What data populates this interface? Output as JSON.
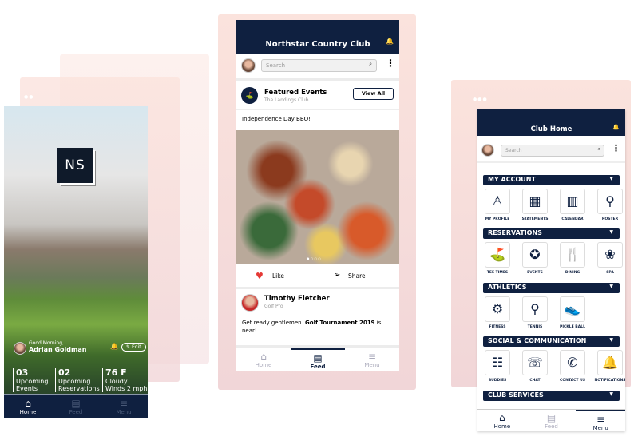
{
  "left": {
    "logo": "NS",
    "greeting": "Good Morning,",
    "user": "Adrian Goldman",
    "edit": "Edit",
    "stats": [
      {
        "value": "03",
        "label1": "Upcoming",
        "label2": "Events"
      },
      {
        "value": "02",
        "label1": "Upcoming",
        "label2": "Reservations"
      },
      {
        "value": "76 F",
        "label1": "Cloudy",
        "label2": "Winds 2 mph"
      }
    ],
    "nav": [
      {
        "icon": "home-icon",
        "label": "Home"
      },
      {
        "icon": "feed-icon",
        "label": "Feed"
      },
      {
        "icon": "menu-icon",
        "label": "Menu"
      }
    ]
  },
  "center": {
    "title": "Northstar Country Club",
    "search_placeholder": "Search",
    "featured": {
      "title": "Featured Events",
      "subtitle": "The Landings Club",
      "view_all": "View All",
      "post": "Independence Day BBQ!",
      "like": "Like",
      "share": "Share"
    },
    "post": {
      "author": "Timothy Fletcher",
      "role": "Golf Pro",
      "text_pre": "Get ready gentlemen. ",
      "text_bold": "Golf Tournament 2019",
      "text_post": " is near!"
    },
    "nav": [
      {
        "icon": "home-icon",
        "label": "Home"
      },
      {
        "icon": "feed-icon",
        "label": "Feed"
      },
      {
        "icon": "menu-icon",
        "label": "Menu"
      }
    ]
  },
  "right": {
    "title": "Club Home",
    "search_placeholder": "Search",
    "sections": [
      {
        "title": "MY ACCOUNT",
        "items": [
          {
            "label": "MY PROFILE",
            "icon": "profile-icon"
          },
          {
            "label": "STATEMENTS",
            "icon": "statements-icon"
          },
          {
            "label": "CALENDAR",
            "icon": "calendar-icon"
          },
          {
            "label": "ROSTER",
            "icon": "roster-icon"
          }
        ]
      },
      {
        "title": "RESERVATIONS",
        "items": [
          {
            "label": "TEE TIMES",
            "icon": "golfer-icon"
          },
          {
            "label": "EVENTS",
            "icon": "events-icon"
          },
          {
            "label": "DINING",
            "icon": "dining-icon"
          },
          {
            "label": "SPA",
            "icon": "lotus-icon"
          }
        ]
      },
      {
        "title": "ATHLETICS",
        "items": [
          {
            "label": "FITNESS",
            "icon": "bike-icon"
          },
          {
            "label": "TENNIS",
            "icon": "tennis-icon"
          },
          {
            "label": "PICKLE BALL",
            "icon": "shoe-icon"
          }
        ]
      },
      {
        "title": "SOCIAL & COMMUNICATION",
        "items": [
          {
            "label": "BUDDIES",
            "icon": "group-icon"
          },
          {
            "label": "CHAT",
            "icon": "chat-icon"
          },
          {
            "label": "CONTACT US",
            "icon": "phone-icon"
          },
          {
            "label": "NOTIFICATIONS",
            "icon": "bell-icon"
          }
        ]
      },
      {
        "title": "CLUB SERVICES",
        "items": []
      }
    ],
    "nav": [
      {
        "icon": "home-icon",
        "label": "Home"
      },
      {
        "icon": "feed-icon",
        "label": "Feed"
      },
      {
        "icon": "menu-icon",
        "label": "Menu"
      }
    ]
  },
  "colors": {
    "navy": "#0f2040",
    "accent_red": "#e53935",
    "panel_pink": "#f6dcd8"
  }
}
